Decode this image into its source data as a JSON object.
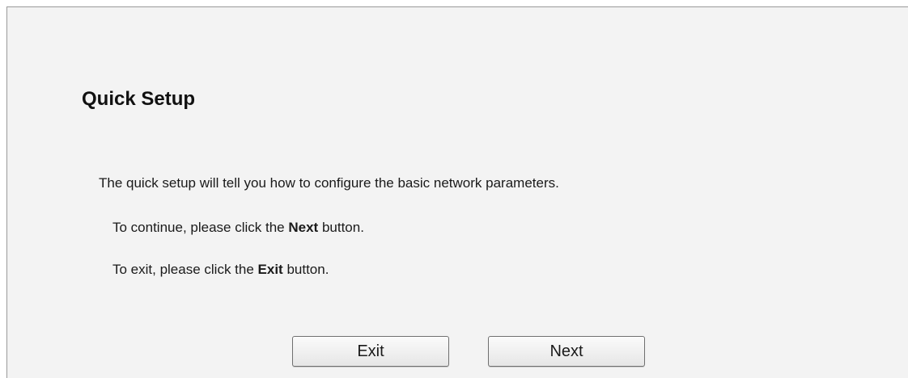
{
  "page": {
    "title": "Quick Setup"
  },
  "messages": {
    "intro": "The quick setup will tell you how to configure the basic network parameters.",
    "continue_prefix": "To continue, please click the ",
    "continue_keyword": "Next",
    "continue_suffix": " button.",
    "exit_prefix": "To exit, please click the ",
    "exit_keyword": "Exit",
    "exit_suffix": " button."
  },
  "buttons": {
    "exit_label": "Exit",
    "next_label": "Next"
  }
}
